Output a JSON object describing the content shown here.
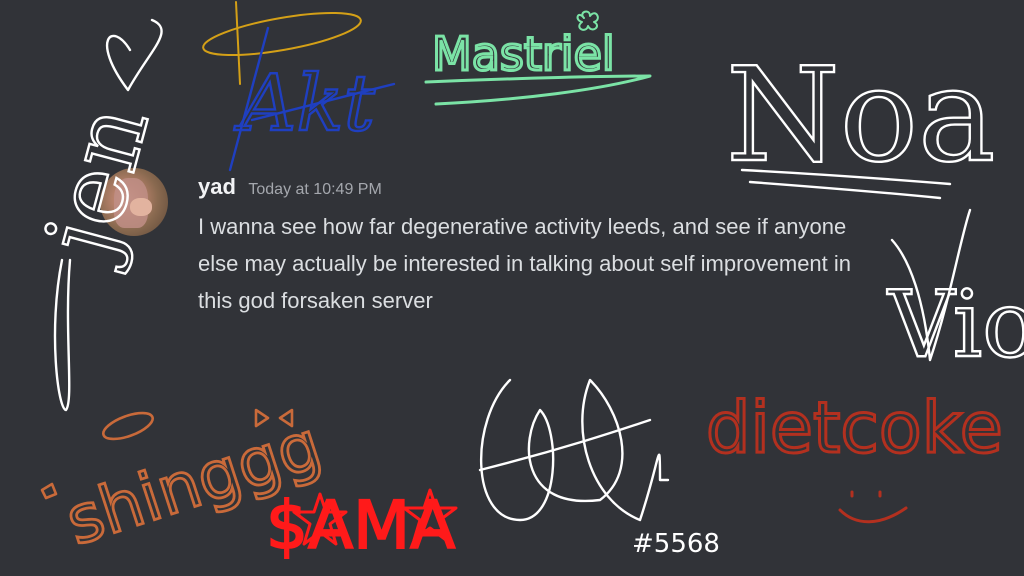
{
  "message": {
    "username": "yad",
    "timestamp": "Today at 10:49 PM",
    "content": "I wanna see how far degenerative activity leeds, and see if anyone else may actually be interested in talking about self improvement in this god forsaken server"
  },
  "signatures": [
    {
      "text": "jen",
      "color": "#ffffff"
    },
    {
      "text": "Akt",
      "color": "#1f3fc0"
    },
    {
      "text": "Mastriel",
      "color": "#7be3a6"
    },
    {
      "text": "Noa",
      "color": "#ffffff"
    },
    {
      "text": "Viole",
      "color": "#ffffff"
    },
    {
      "text": "shinggg",
      "color": "#c96a3a"
    },
    {
      "text": "$AMA",
      "color": "#ff1a1a"
    },
    {
      "text": "#5568",
      "color": "#ffffff"
    },
    {
      "text": "dietcoke",
      "color": "#b3301f"
    }
  ]
}
